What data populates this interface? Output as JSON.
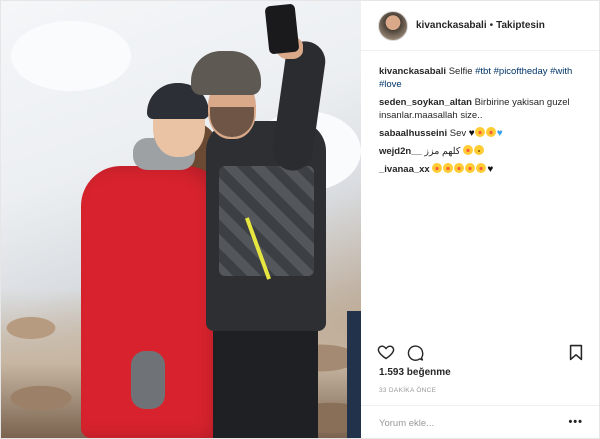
{
  "post": {
    "username": "kivanckasabali",
    "separator": "•",
    "follow_status": "Takiptesin",
    "caption": {
      "user": "kivanckasabali",
      "text": "Selfie",
      "hashtags": [
        "#tbt",
        "#picoftheday",
        "#with",
        "#love"
      ]
    },
    "comments": [
      {
        "user": "seden_soykan_altan",
        "text": "Birbirine yakisan guzel insanlar.maasallah size.."
      },
      {
        "user": "sabaalhusseini",
        "text": "Sev"
      },
      {
        "user": "wejd2n__",
        "text": "كلهم مزز"
      },
      {
        "user": "_ivanaa_xx",
        "text": ""
      }
    ],
    "likes": "1.593 beğenme",
    "timestamp": "33 DAKİKA ÖNCE",
    "add_comment_placeholder": "Yorum ekle...",
    "more_options": "•••"
  },
  "icons": {
    "like": "heart-icon",
    "comment": "comment-icon",
    "save": "bookmark-icon"
  },
  "colors": {
    "coat": "#d8232e",
    "hashtag": "#003569",
    "text": "#262626",
    "muted": "#999999"
  }
}
